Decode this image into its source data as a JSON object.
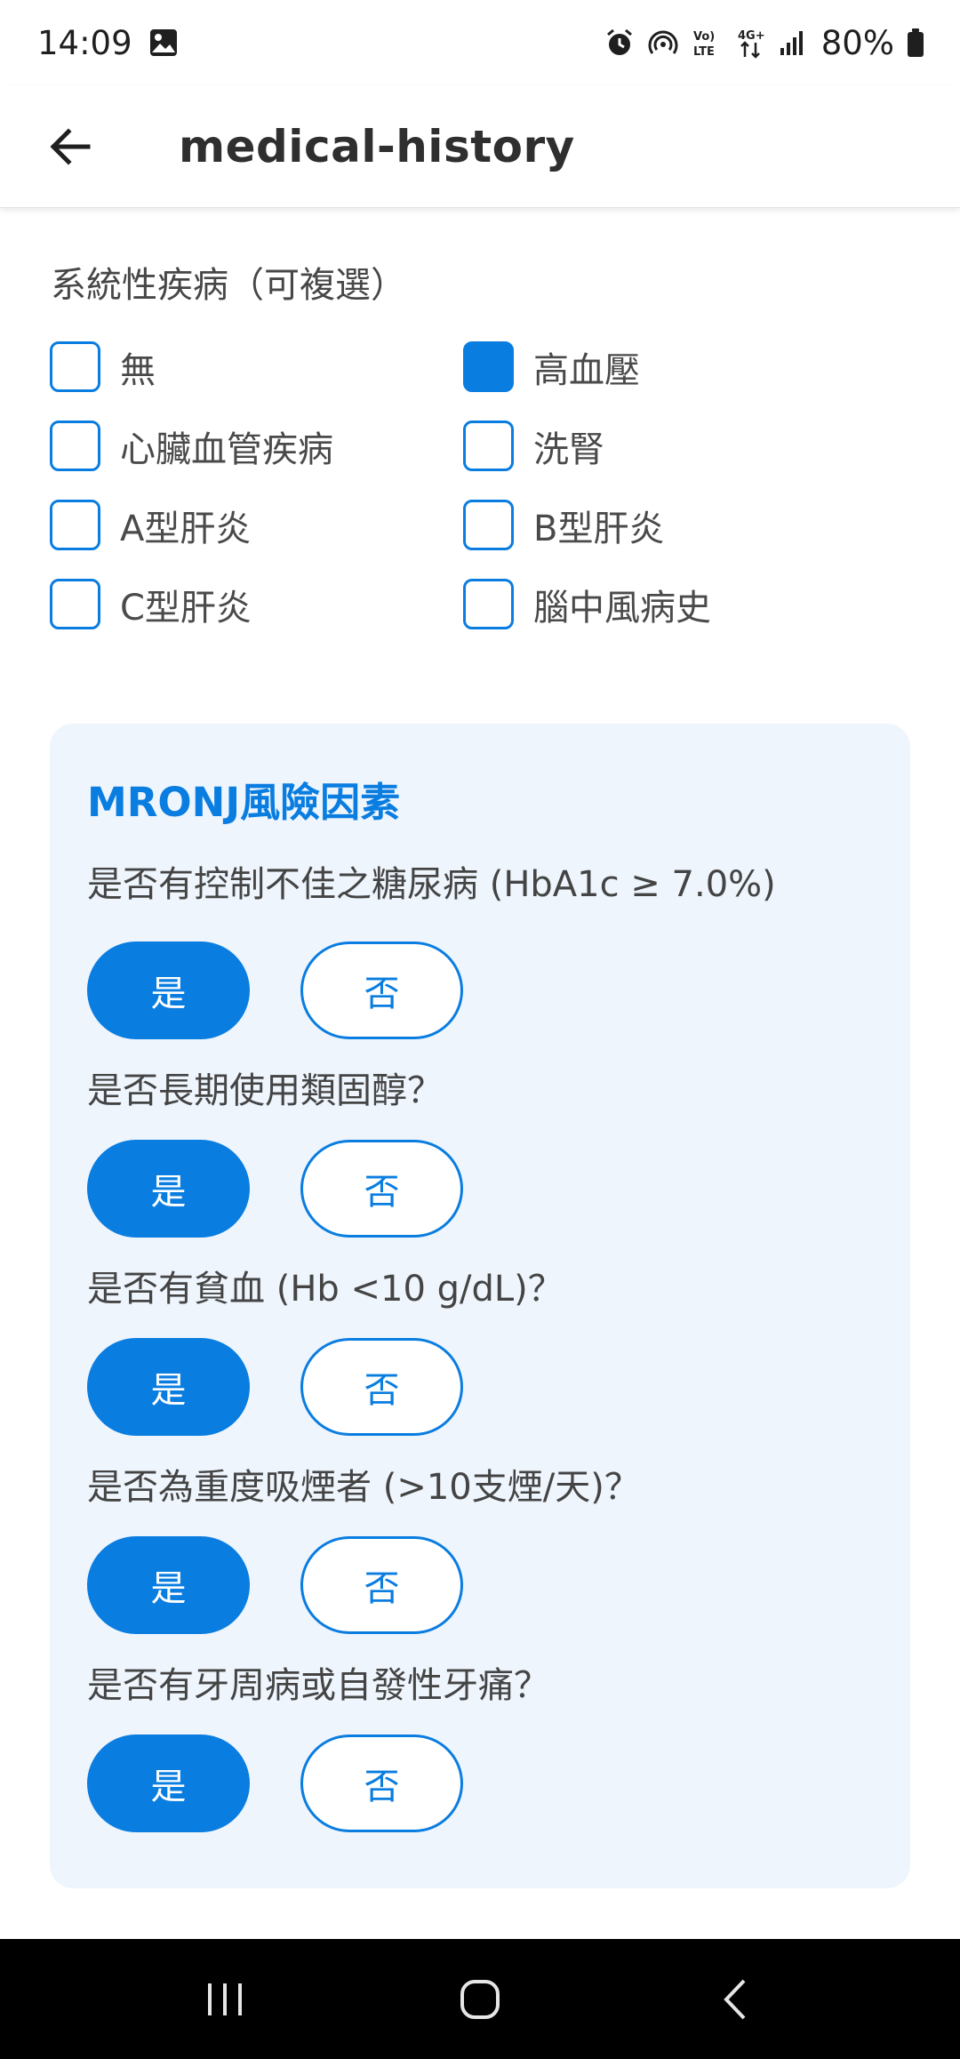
{
  "status_bar": {
    "time": "14:09",
    "battery": "80%",
    "network": "4G+",
    "volte": "Vo) LTE",
    "icons": [
      "image-icon",
      "alarm-icon",
      "hotspot-icon",
      "volte-icon",
      "data-arrows-icon",
      "signal-icon",
      "battery-icon"
    ]
  },
  "app_bar": {
    "title": "medical-history",
    "back_icon": "arrow-left-icon"
  },
  "systemic": {
    "title": "系統性疾病（可複選）",
    "options": [
      {
        "label": "無",
        "checked": false
      },
      {
        "label": "高血壓",
        "checked": true
      },
      {
        "label": "心臟血管疾病",
        "checked": false
      },
      {
        "label": "洗腎",
        "checked": false
      },
      {
        "label": "A型肝炎",
        "checked": false
      },
      {
        "label": "B型肝炎",
        "checked": false
      },
      {
        "label": "C型肝炎",
        "checked": false
      },
      {
        "label": "腦中風病史",
        "checked": false
      }
    ]
  },
  "mronj": {
    "title": "MRONJ風險因素",
    "yes_label": "是",
    "no_label": "否",
    "questions": [
      {
        "text": "是否有控制不佳之糖尿病 (HbA1c ≥ 7.0%)",
        "selected": "yes"
      },
      {
        "text": "是否長期使用類固醇？",
        "selected": "yes"
      },
      {
        "text": "是否有貧血 (Hb <10 g/dL)？",
        "selected": "yes"
      },
      {
        "text": "是否為重度吸煙者 (>10支煙/天)？",
        "selected": "yes"
      },
      {
        "text": "是否有牙周病或自發性牙痛？",
        "selected": "yes"
      }
    ]
  },
  "colors": {
    "accent": "#0a7de0",
    "card_bg": "#eef5fd",
    "text": "#444444"
  },
  "nav_bar": {
    "icons": [
      "recents-icon",
      "home-icon",
      "back-icon"
    ]
  }
}
